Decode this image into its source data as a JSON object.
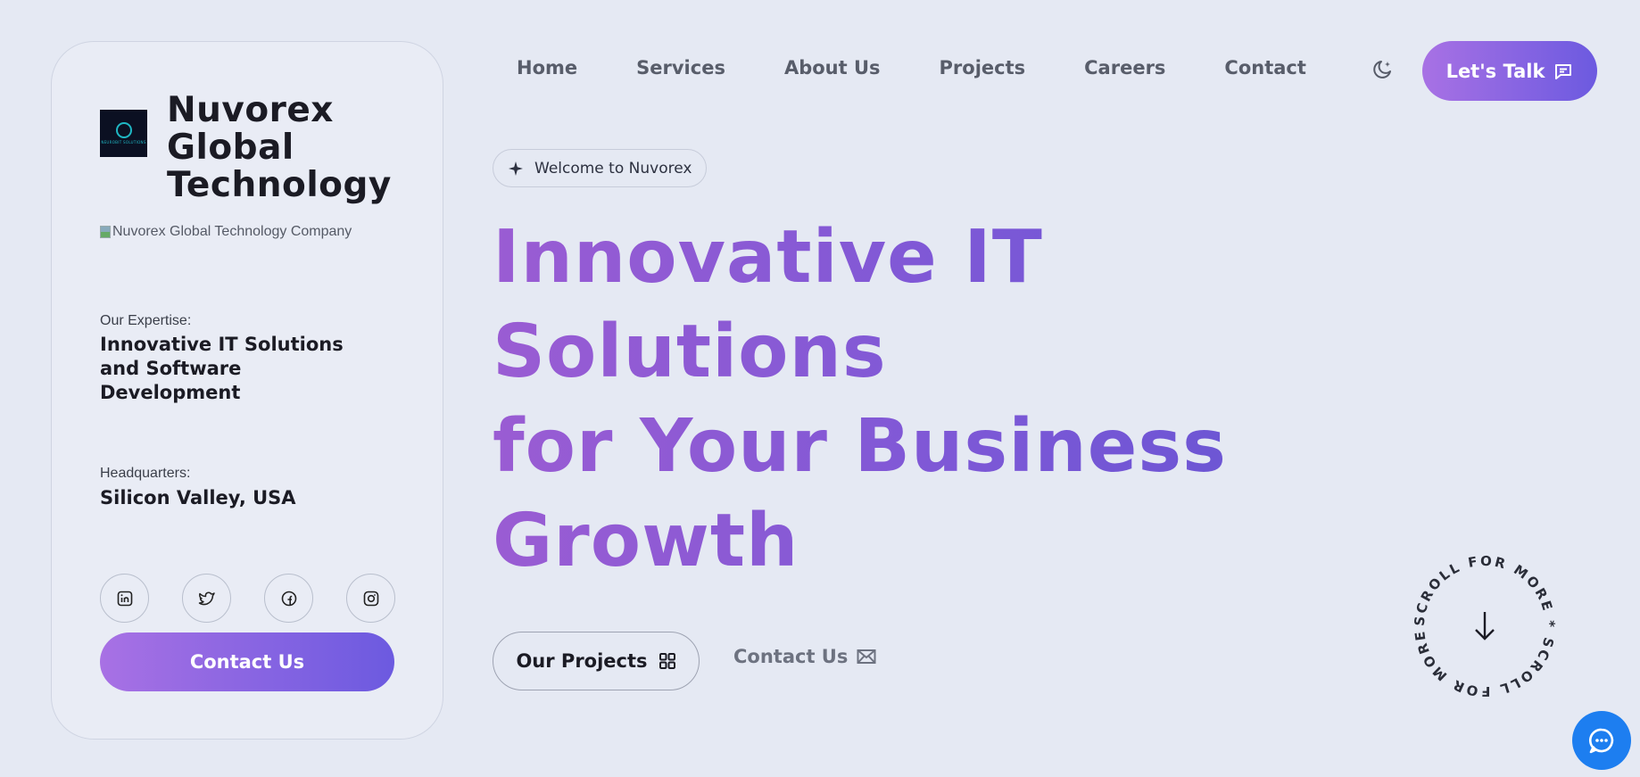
{
  "brand": {
    "name_lines": [
      "Nuvorex",
      "Global",
      "Technology"
    ],
    "logo_tag": "NEUROBIT SOLUTIONS",
    "image_alt": "Nuvorex Global Technology Company"
  },
  "expertise": {
    "label": "Our Expertise:",
    "lines": [
      "Innovative IT Solutions",
      "and Software",
      "Development"
    ]
  },
  "headquarters": {
    "label": "Headquarters:",
    "value": "Silicon Valley, USA"
  },
  "socials": [
    "linkedin-icon",
    "twitter-icon",
    "facebook-icon",
    "instagram-icon"
  ],
  "card": {
    "contact_label": "Contact Us"
  },
  "nav": {
    "items": [
      "Home",
      "Services",
      "About Us",
      "Projects",
      "Careers",
      "Contact"
    ],
    "cta_label": "Let's Talk",
    "theme_icon": "moon-stars-icon"
  },
  "hero": {
    "badge": "Welcome to Nuvorex",
    "title_lines": [
      "Innovative IT",
      "Solutions",
      "for Your Business",
      "Growth"
    ],
    "primary_label": "Our Projects",
    "secondary_label": "Contact Us"
  },
  "scroll": {
    "text": "SCROLL FOR MORE * SCROLL FOR MORE * "
  },
  "colors": {
    "background": "#e5e9f3",
    "accent_start": "#a871e4",
    "accent_end": "#6c5ae0",
    "chat_button": "#1d7ef0",
    "text_dark": "#1b1b24"
  }
}
